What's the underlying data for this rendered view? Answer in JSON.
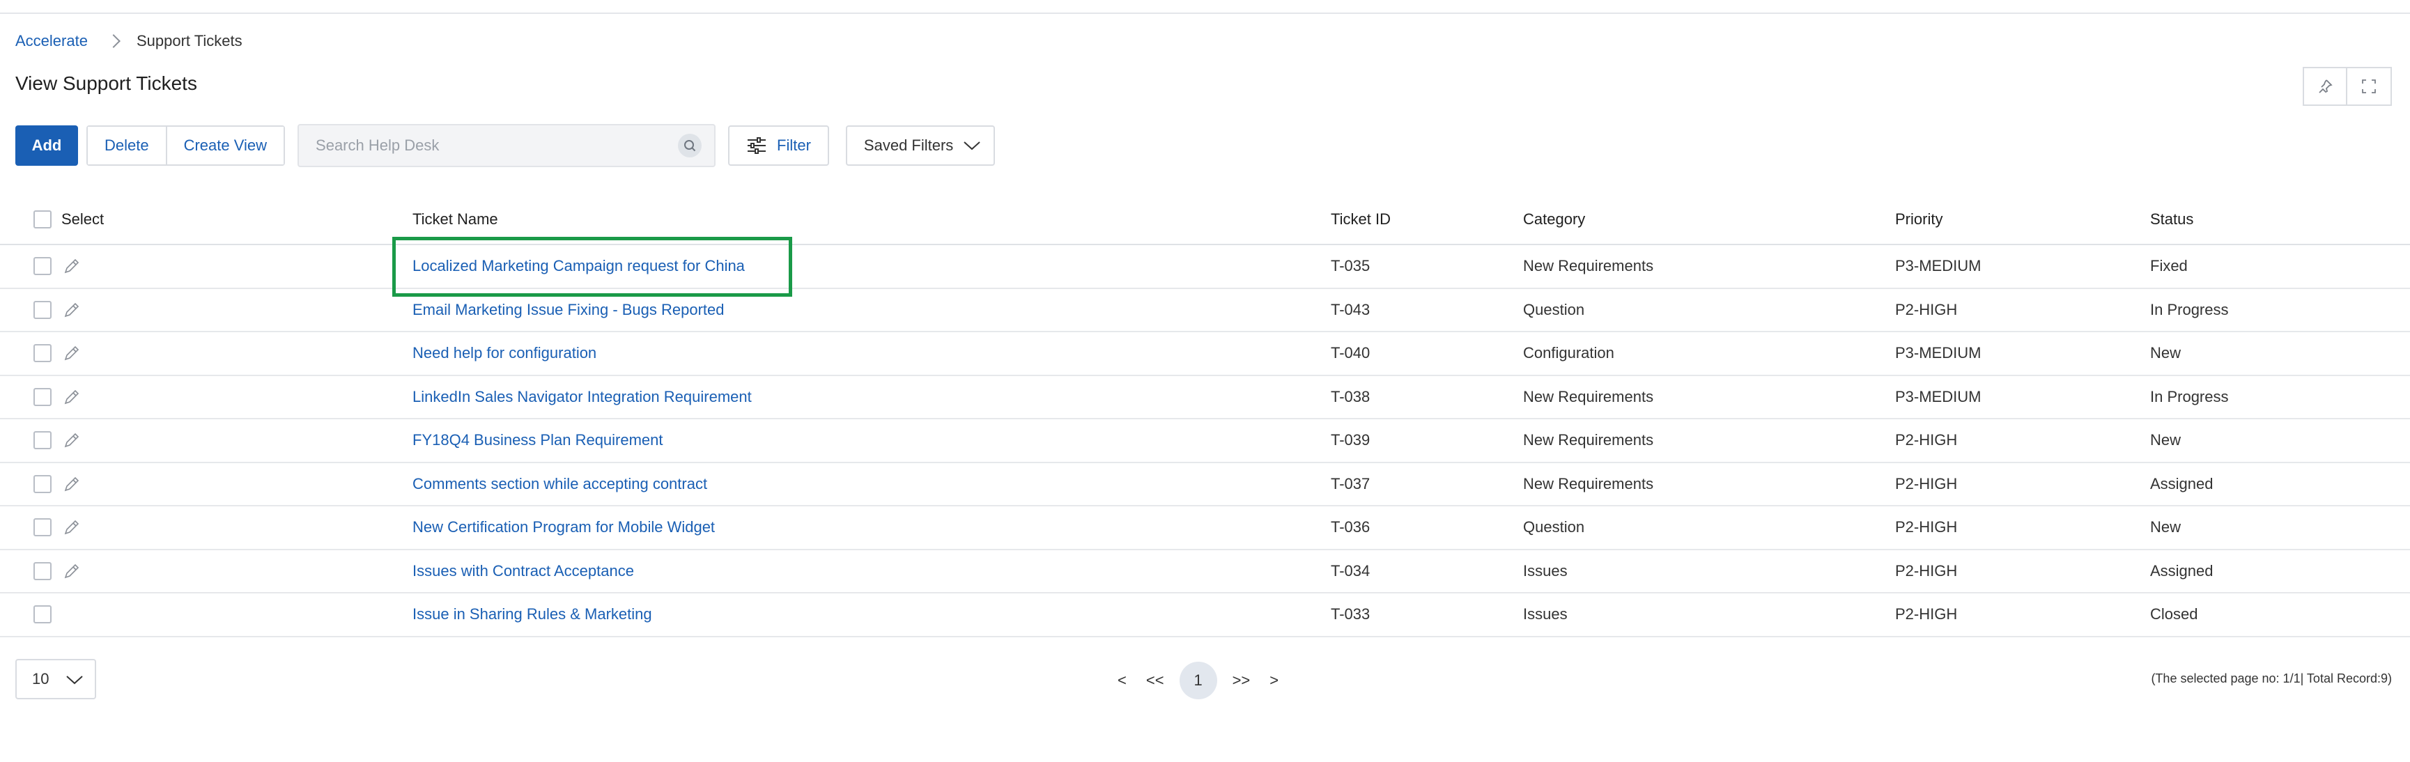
{
  "breadcrumb": {
    "root": "Accelerate",
    "current": "Support Tickets"
  },
  "page_title": "View Support Tickets",
  "toolbar": {
    "add_label": "Add",
    "delete_label": "Delete",
    "create_view_label": "Create View",
    "search_placeholder": "Search Help Desk",
    "search_value": "",
    "filter_label": "Filter",
    "saved_filters_label": "Saved Filters"
  },
  "table": {
    "headers": {
      "select": "Select",
      "name": "Ticket Name",
      "id": "Ticket ID",
      "category": "Category",
      "priority": "Priority",
      "status": "Status"
    },
    "rows": [
      {
        "name": "Localized Marketing Campaign request for China",
        "id": "T-035",
        "category": "New Requirements",
        "priority": "P3-MEDIUM",
        "status": "Fixed",
        "editable": true
      },
      {
        "name": "Email Marketing Issue Fixing - Bugs Reported",
        "id": "T-043",
        "category": "Question",
        "priority": "P2-HIGH",
        "status": "In Progress",
        "editable": true
      },
      {
        "name": "Need help for configuration",
        "id": "T-040",
        "category": "Configuration",
        "priority": "P3-MEDIUM",
        "status": "New",
        "editable": true
      },
      {
        "name": "LinkedIn Sales Navigator Integration Requirement",
        "id": "T-038",
        "category": "New Requirements",
        "priority": "P3-MEDIUM",
        "status": "In Progress",
        "editable": true
      },
      {
        "name": "FY18Q4 Business Plan Requirement",
        "id": "T-039",
        "category": "New Requirements",
        "priority": "P2-HIGH",
        "status": "New",
        "editable": true
      },
      {
        "name": "Comments section while accepting contract",
        "id": "T-037",
        "category": "New Requirements",
        "priority": "P2-HIGH",
        "status": "Assigned",
        "editable": true
      },
      {
        "name": "New Certification Program for Mobile Widget",
        "id": "T-036",
        "category": "Question",
        "priority": "P2-HIGH",
        "status": "New",
        "editable": true
      },
      {
        "name": "Issues with Contract Acceptance",
        "id": "T-034",
        "category": "Issues",
        "priority": "P2-HIGH",
        "status": "Assigned",
        "editable": true
      },
      {
        "name": "Issue in Sharing Rules & Marketing",
        "id": "T-033",
        "category": "Issues",
        "priority": "P2-HIGH",
        "status": "Closed",
        "editable": false
      }
    ]
  },
  "pagination": {
    "page_size": "10",
    "prev": "<",
    "first": "<<",
    "current_page": "1",
    "last": ">>",
    "next": ">",
    "info": "(The selected page no: 1/1| Total Record:9)"
  },
  "colors": {
    "accent": "#1a5fb4",
    "highlight": "#1a9a48"
  },
  "icons": [
    "chevron-right-icon",
    "pin-icon",
    "fullscreen-icon",
    "search-icon",
    "filter-sliders-icon",
    "chevron-down-icon",
    "pencil-icon"
  ]
}
